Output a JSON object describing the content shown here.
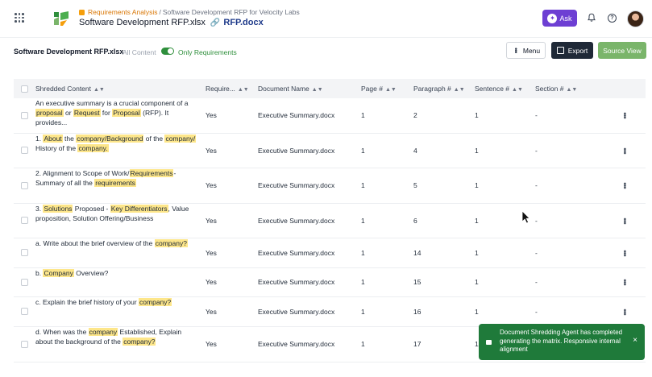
{
  "header": {
    "breadcrumb": {
      "section": "Requirements Analysis",
      "separator": "/",
      "project": "Software Development RFP for Velocity Labs"
    },
    "file_title": "Software Development RFP.xlsx",
    "linked_file": "RFP.docx",
    "ask_label": "Ask"
  },
  "toolbar": {
    "sheet_name": "Software Development RFP.xlsx",
    "segment_all": "All Content",
    "segment_only": "Only Requirements",
    "toggle_on": true,
    "menu_label": "Menu",
    "export_label": "Export",
    "source_view_label": "Source View"
  },
  "table": {
    "columns": [
      "Shredded Content",
      "Require...",
      "Document Name",
      "Page #",
      "Paragraph #",
      "Sentence #",
      "Section #"
    ],
    "rows": [
      {
        "content": "An executive summary is a crucial component of a proposal or Request for Proposal (RFP). It provides...",
        "required": "Yes",
        "document": "Executive Summary.docx",
        "page": "1",
        "paragraph": "2",
        "sentence": "1",
        "section": "-"
      },
      {
        "content": "1. About the company/Background of the company/ History of the company.",
        "required": "Yes",
        "document": "Executive Summary.docx",
        "page": "1",
        "paragraph": "4",
        "sentence": "1",
        "section": "-"
      },
      {
        "content": "2. Alignment to Scope of Work/Requirements- Summary of all the requirements",
        "required": "Yes",
        "document": "Executive Summary.docx",
        "page": "1",
        "paragraph": "5",
        "sentence": "1",
        "section": "-"
      },
      {
        "content": "3.  Solutions Proposed - Key Differentiators, Value proposition, Solution Offering/Business",
        "required": "Yes",
        "document": "Executive Summary.docx",
        "page": "1",
        "paragraph": "6",
        "sentence": "1",
        "section": "-"
      },
      {
        "content": "a. Write about the brief overview of the company?",
        "required": "Yes",
        "document": "Executive Summary.docx",
        "page": "1",
        "paragraph": "14",
        "sentence": "1",
        "section": "-"
      },
      {
        "content": "b. Company Overview?",
        "required": "Yes",
        "document": "Executive Summary.docx",
        "page": "1",
        "paragraph": "15",
        "sentence": "1",
        "section": "-"
      },
      {
        "content": "c. Explain the brief history of your company?",
        "required": "Yes",
        "document": "Executive Summary.docx",
        "page": "1",
        "paragraph": "16",
        "sentence": "1",
        "section": "-"
      },
      {
        "content": "d. When was the company Established, Explain about the background of the company?",
        "required": "Yes",
        "document": "Executive Summary.docx",
        "page": "1",
        "paragraph": "17",
        "sentence": "1",
        "section": "-"
      }
    ],
    "highlights": [
      [
        "proposal",
        "Request",
        "Proposal"
      ],
      [
        "About",
        "company/Background",
        "company/",
        "company."
      ],
      [
        "Requirements",
        "requirements"
      ],
      [
        "Solutions",
        "Key Differentiators"
      ],
      [
        "company?"
      ],
      [
        "Company"
      ],
      [
        "company?"
      ],
      [
        "company",
        "company?"
      ]
    ]
  },
  "toast": {
    "message": "Document Shredding Agent has completed generating the matrix. Responsive internal alignment",
    "close": "×"
  },
  "colors": {
    "accent_purple": "#6d3fd3",
    "toggle_green": "#2f8f3c",
    "source_view_green": "#7ab56a",
    "toast_green": "#1f7a3a",
    "highlight_yellow": "#fde68a",
    "export_dark": "#1f2937"
  }
}
